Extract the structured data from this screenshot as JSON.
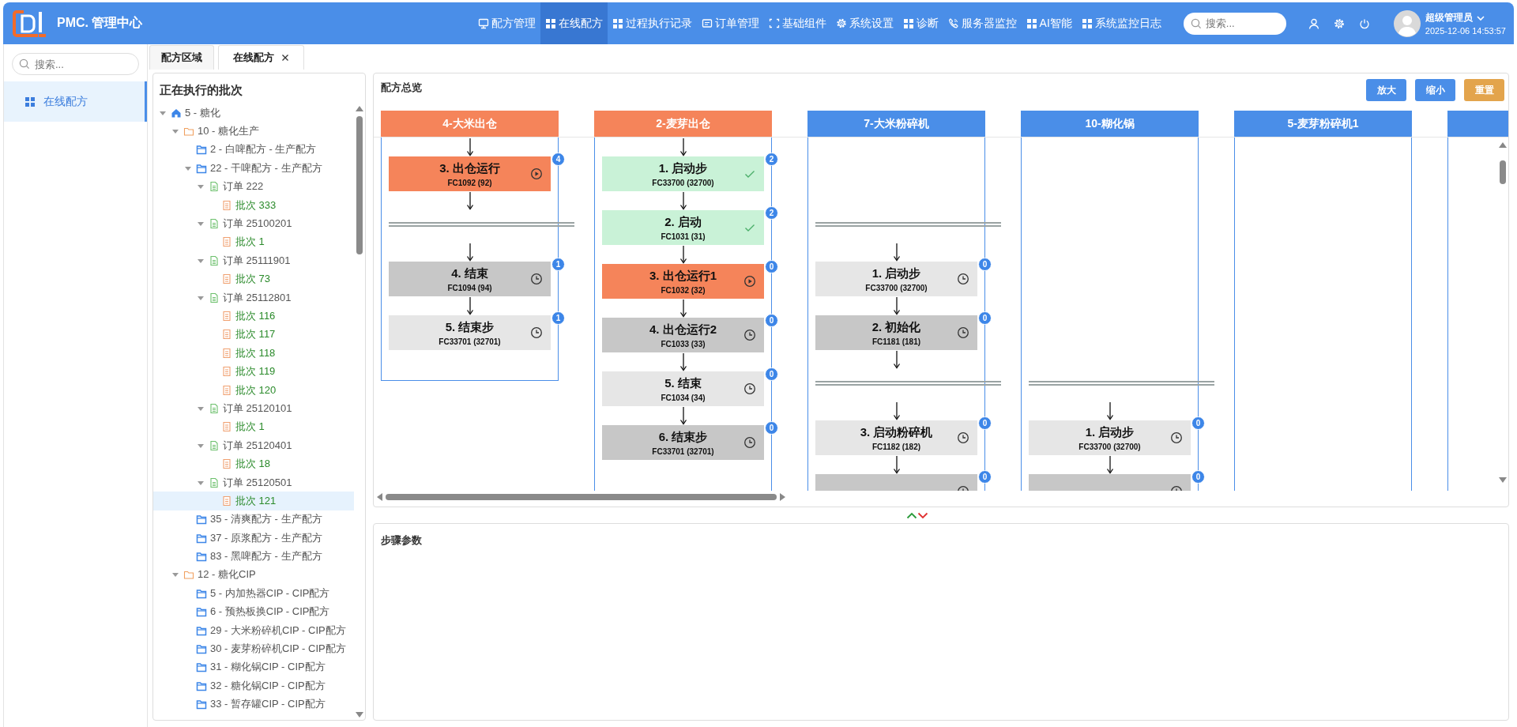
{
  "header": {
    "title": "PMC. 管理中心",
    "nav": [
      {
        "label": "配方管理",
        "kind": "monitor",
        "selected": false
      },
      {
        "label": "在线配方",
        "kind": "grid",
        "selected": true
      },
      {
        "label": "过程执行记录",
        "kind": "grid",
        "selected": false
      },
      {
        "label": "订单管理",
        "kind": "card",
        "selected": false
      },
      {
        "label": "基础组件",
        "kind": "frame",
        "selected": false
      },
      {
        "label": "系统设置",
        "kind": "gear",
        "selected": false
      },
      {
        "label": "诊断",
        "kind": "grid",
        "selected": false
      },
      {
        "label": "服务器监控",
        "kind": "phone",
        "selected": false
      },
      {
        "label": "AI智能",
        "kind": "grid",
        "selected": false
      },
      {
        "label": "系统监控日志",
        "kind": "grid",
        "selected": false
      }
    ],
    "search": {
      "placeholder": "搜索..."
    },
    "user": {
      "name": "超级管理员",
      "datetime": "2025-12-06 14:53:57"
    }
  },
  "sidebar": {
    "search": {
      "placeholder": "搜索..."
    },
    "items": [
      {
        "label": "在线配方",
        "selected": true
      }
    ]
  },
  "tabs": [
    {
      "label": "配方区域",
      "selected": false,
      "closable": false
    },
    {
      "label": "在线配方",
      "selected": true,
      "closable": true
    }
  ],
  "batch_panel": {
    "title": "正在执行的批次",
    "tree": [
      {
        "label": "5 - 糖化",
        "kind": "home",
        "expanded": true,
        "selected": false,
        "children": [
          {
            "label": "10 - 糖化生产",
            "kind": "folder",
            "expanded": true,
            "selected": false,
            "children": [
              {
                "label": "2 - 白啤配方 - 生产配方",
                "kind": "recipe",
                "selected": false
              },
              {
                "label": "22 - 干啤配方 - 生产配方",
                "kind": "recipe",
                "expanded": true,
                "selected": false,
                "children": [
                  {
                    "label": "订单 222",
                    "kind": "order",
                    "expanded": true,
                    "selected": false,
                    "children": [
                      {
                        "label": "批次 333",
                        "kind": "batch",
                        "selected": false
                      }
                    ]
                  },
                  {
                    "label": "订单 25100201",
                    "kind": "order",
                    "expanded": true,
                    "selected": false,
                    "children": [
                      {
                        "label": "批次 1",
                        "kind": "batch",
                        "selected": false
                      }
                    ]
                  },
                  {
                    "label": "订单 25111901",
                    "kind": "order",
                    "expanded": true,
                    "selected": false,
                    "children": [
                      {
                        "label": "批次 73",
                        "kind": "batch",
                        "selected": false
                      }
                    ]
                  },
                  {
                    "label": "订单 25112801",
                    "kind": "order",
                    "expanded": true,
                    "selected": false,
                    "children": [
                      {
                        "label": "批次 116",
                        "kind": "batch",
                        "selected": false
                      },
                      {
                        "label": "批次 117",
                        "kind": "batch",
                        "selected": false
                      },
                      {
                        "label": "批次 118",
                        "kind": "batch",
                        "selected": false
                      },
                      {
                        "label": "批次 119",
                        "kind": "batch",
                        "selected": false
                      },
                      {
                        "label": "批次 120",
                        "kind": "batch",
                        "selected": false
                      }
                    ]
                  },
                  {
                    "label": "订单 25120101",
                    "kind": "order",
                    "expanded": true,
                    "selected": false,
                    "children": [
                      {
                        "label": "批次 1",
                        "kind": "batch",
                        "selected": false
                      }
                    ]
                  },
                  {
                    "label": "订单 25120401",
                    "kind": "order",
                    "expanded": true,
                    "selected": false,
                    "children": [
                      {
                        "label": "批次 18",
                        "kind": "batch",
                        "selected": false
                      }
                    ]
                  },
                  {
                    "label": "订单 25120501",
                    "kind": "order",
                    "expanded": true,
                    "selected": false,
                    "children": [
                      {
                        "label": "批次 121",
                        "kind": "batch",
                        "selected": true
                      }
                    ]
                  }
                ]
              },
              {
                "label": "35 - 清爽配方 - 生产配方",
                "kind": "recipe",
                "selected": false
              },
              {
                "label": "37 - 原浆配方 - 生产配方",
                "kind": "recipe",
                "selected": false
              },
              {
                "label": "83 - 黑啤配方 - 生产配方",
                "kind": "recipe",
                "selected": false
              }
            ]
          },
          {
            "label": "12 - 糖化CIP",
            "kind": "folder",
            "expanded": true,
            "selected": false,
            "children": [
              {
                "label": "5 - 内加热器CIP - CIP配方",
                "kind": "recipe",
                "selected": false
              },
              {
                "label": "6 - 预热板换CIP - CIP配方",
                "kind": "recipe",
                "selected": false
              },
              {
                "label": "29 - 大米粉碎机CIP - CIP配方",
                "kind": "recipe",
                "selected": false
              },
              {
                "label": "30 - 麦芽粉碎机CIP - CIP配方",
                "kind": "recipe",
                "selected": false
              },
              {
                "label": "31 - 糊化锅CIP - CIP配方",
                "kind": "recipe",
                "selected": false
              },
              {
                "label": "32 - 糖化锅CIP - CIP配方",
                "kind": "recipe",
                "selected": false
              },
              {
                "label": "33 - 暂存罐CIP - CIP配方",
                "kind": "recipe",
                "selected": false
              }
            ]
          }
        ]
      }
    ]
  },
  "overview": {
    "title": "配方总览",
    "buttons": [
      {
        "label": "放大",
        "kind": "primary"
      },
      {
        "label": "缩小",
        "kind": "primary"
      },
      {
        "label": "重置",
        "kind": "warning"
      }
    ],
    "columns": [
      {
        "title": "4-大米出仓",
        "active": true,
        "phases": [
          {
            "sync": false,
            "steps": [
              {
                "title": "3. 出仓运行",
                "code": "FC1092 (92)",
                "kind": "running",
                "badge": "4"
              }
            ]
          },
          {
            "sync": true,
            "steps": [
              {
                "title": "4. 结束",
                "code": "FC1094 (94)",
                "kind": "waiting",
                "badge": "1"
              },
              {
                "title": "5. 结束步",
                "code": "FC33701 (32701)",
                "kind": "waiting",
                "badge": "1"
              }
            ]
          }
        ]
      },
      {
        "title": "2-麦芽出仓",
        "active": true,
        "phases": [
          {
            "sync": false,
            "steps": [
              {
                "title": "1. 启动步",
                "code": "FC33700 (32700)",
                "kind": "done",
                "badge": "2"
              },
              {
                "title": "2. 启动",
                "code": "FC1031 (31)",
                "kind": "done",
                "badge": "2"
              },
              {
                "title": "3. 出仓运行1",
                "code": "FC1032 (32)",
                "kind": "running",
                "badge": "0"
              },
              {
                "title": "4. 出仓运行2",
                "code": "FC1033 (33)",
                "kind": "waiting",
                "badge": "0"
              },
              {
                "title": "5. 结束",
                "code": "FC1034 (34)",
                "kind": "waiting",
                "badge": "0"
              },
              {
                "title": "6. 结束步",
                "code": "FC33701 (32701)",
                "kind": "waiting",
                "badge": "0"
              }
            ]
          }
        ]
      },
      {
        "title": "7-大米粉碎机",
        "active": false,
        "phases": [
          {
            "sync": false
          },
          {
            "sync": true,
            "steps": [
              {
                "title": "1. 启动步",
                "code": "FC33700 (32700)",
                "kind": "waiting",
                "badge": "0"
              },
              {
                "title": "2. 初始化",
                "code": "FC1181 (181)",
                "kind": "waiting",
                "badge": "0"
              }
            ]
          },
          {
            "sync": true,
            "steps": [
              {
                "title": "3. 启动粉碎机",
                "code": "FC1182 (182)",
                "kind": "waiting",
                "badge": "0"
              },
              {
                "kind": "waiting",
                "badge": "0"
              }
            ]
          }
        ]
      },
      {
        "title": "10-糊化锅",
        "active": false,
        "phases": [
          {
            "sync": false
          },
          {
            "sync": false
          },
          {
            "sync": true,
            "steps": [
              {
                "title": "1. 启动步",
                "code": "FC33700 (32700)",
                "kind": "waiting",
                "badge": "0"
              },
              {
                "kind": "waiting",
                "badge": "0"
              }
            ]
          }
        ]
      },
      {
        "title": "5-麦芽粉碎机1",
        "active": false
      },
      {
        "active": false
      }
    ]
  },
  "step_params": {
    "title": "步骤参数"
  }
}
